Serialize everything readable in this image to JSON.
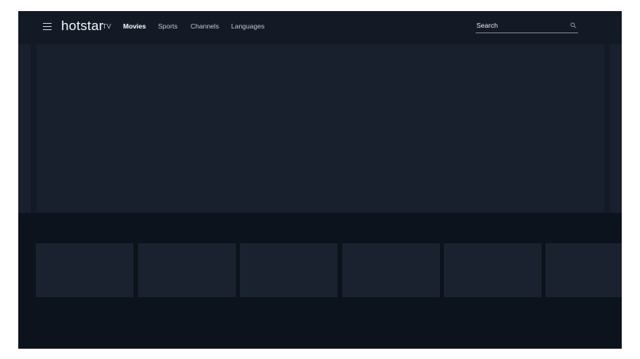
{
  "header": {
    "logo": "hotstar",
    "nav": [
      {
        "label": "TV",
        "active": false
      },
      {
        "label": "Movies",
        "active": true
      },
      {
        "label": "Sports",
        "active": false
      },
      {
        "label": "Channels",
        "active": false
      },
      {
        "label": "Languages",
        "active": false
      }
    ],
    "search": {
      "label": "Search",
      "icon": "search-icon"
    },
    "menu_icon": "hamburger-menu-icon"
  },
  "hero": {
    "slides_visible": 3
  },
  "tray": {
    "cards_visible": 6
  },
  "colors": {
    "app_background": "#0d131c",
    "header_background": "#131a26",
    "card_placeholder": "#1a2230",
    "text_primary": "#ffffff",
    "text_secondary": "#c0c6cf"
  }
}
